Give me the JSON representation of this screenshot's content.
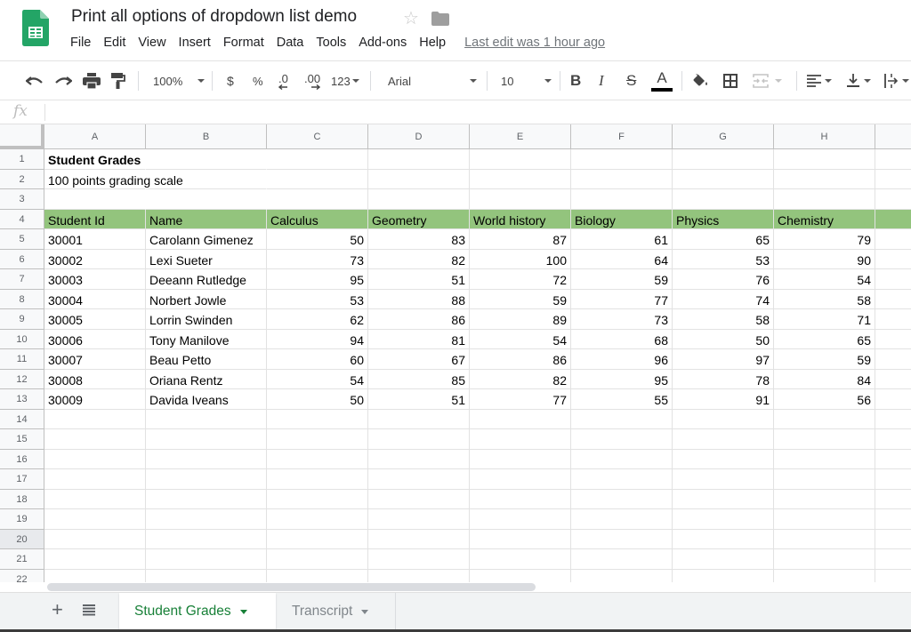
{
  "app": {
    "title": "Print all options of dropdown list demo",
    "menu": [
      "File",
      "Edit",
      "View",
      "Insert",
      "Format",
      "Data",
      "Tools",
      "Add-ons",
      "Help"
    ],
    "last_edit": "Last edit was 1 hour ago"
  },
  "toolbar": {
    "zoom": "100%",
    "currency": "$",
    "percent": "%",
    "decrease_decimal": ".0",
    "increase_decimal": ".00",
    "more_formats": "123",
    "font": "Arial",
    "font_size": "10",
    "bold": "B",
    "italic": "I",
    "strike": "S",
    "text_color": "A",
    "text_color_value": "#000000"
  },
  "formula_bar": {
    "fx_label": "fx",
    "value": ""
  },
  "sheet": {
    "columns": [
      "A",
      "B",
      "C",
      "D",
      "E",
      "F",
      "G",
      "H",
      ""
    ],
    "row_numbers": [
      "1",
      "2",
      "3",
      "4",
      "5",
      "6",
      "7",
      "8",
      "9",
      "10",
      "11",
      "12",
      "13",
      "14",
      "15",
      "16",
      "17",
      "18",
      "19",
      "20",
      "21",
      "22"
    ],
    "selected_row": "20",
    "title": "Student Grades",
    "subtitle": "100 points grading scale",
    "header_color": "#93c47d",
    "headers": [
      "Student Id",
      "Name",
      "Calculus",
      "Geometry",
      "World history",
      "Biology",
      "Physics",
      "Chemistry"
    ],
    "rows": [
      [
        "30001",
        "Carolann Gimenez",
        "50",
        "83",
        "87",
        "61",
        "65",
        "79"
      ],
      [
        "30002",
        "Lexi Sueter",
        "73",
        "82",
        "100",
        "64",
        "53",
        "90"
      ],
      [
        "30003",
        "Deeann Rutledge",
        "95",
        "51",
        "72",
        "59",
        "76",
        "54"
      ],
      [
        "30004",
        "Norbert Jowle",
        "53",
        "88",
        "59",
        "77",
        "74",
        "58"
      ],
      [
        "30005",
        "Lorrin Swinden",
        "62",
        "86",
        "89",
        "73",
        "58",
        "71"
      ],
      [
        "30006",
        "Tony Manilove",
        "94",
        "81",
        "54",
        "68",
        "50",
        "65"
      ],
      [
        "30007",
        "Beau Petto",
        "60",
        "67",
        "86",
        "96",
        "97",
        "59"
      ],
      [
        "30008",
        "Oriana Rentz",
        "54",
        "85",
        "82",
        "95",
        "78",
        "84"
      ],
      [
        "30009",
        "Davida Iveans",
        "50",
        "51",
        "77",
        "55",
        "91",
        "56"
      ]
    ]
  },
  "tabs": {
    "items": [
      {
        "label": "Student Grades",
        "active": true
      },
      {
        "label": "Transcript",
        "active": false
      }
    ]
  }
}
